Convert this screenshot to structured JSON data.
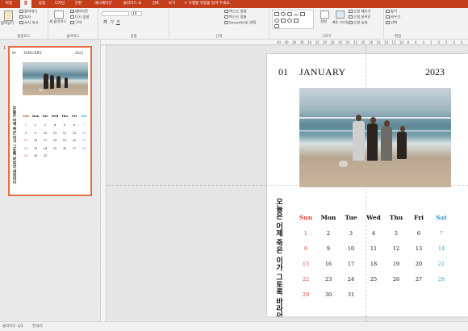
{
  "menu": {
    "tabs": [
      {
        "label": "파일",
        "active": false
      },
      {
        "label": "홈",
        "active": true
      },
      {
        "label": "삽입",
        "active": false
      },
      {
        "label": "디자인",
        "active": false
      },
      {
        "label": "전환",
        "active": false
      },
      {
        "label": "애니메이션",
        "active": false
      },
      {
        "label": "슬라이드 쇼",
        "active": false
      },
      {
        "label": "검토",
        "active": false
      },
      {
        "label": "보기",
        "active": false
      }
    ],
    "tell_me": "수행할 작업을 알려 주세요."
  },
  "ribbon": {
    "clipboard": {
      "paste": "붙여넣기",
      "cut": "잘라내기",
      "copy": "복사",
      "format_painter": "서식 복사",
      "label": "클립보드"
    },
    "slides": {
      "new_slide": "새 슬라이드",
      "layout": "레이아웃",
      "reset": "다시 설정",
      "section": "구역",
      "label": "슬라이드"
    },
    "font": {
      "size": "18",
      "bold": "가",
      "italic": "가",
      "underline": "가",
      "label": "글꼴"
    },
    "paragraph": {
      "text_direction": "텍스트 방향",
      "align_text": "텍스트 맞춤",
      "smartart": "SmartArt로 변환",
      "label": "단락"
    },
    "drawing": {
      "arrange": "정렬",
      "quick_styles": "빠른 스타일",
      "shape_fill": "도형 채우기",
      "shape_outline": "도형 윤곽선",
      "shape_effects": "도형 효과",
      "label": "그리기"
    },
    "editing": {
      "find": "찾기",
      "replace": "바꾸기",
      "select": "선택",
      "label": "편집"
    }
  },
  "thumbnail": {
    "number": "1"
  },
  "ruler": {
    "h_ticks": [
      "44",
      "40",
      "38",
      "36",
      "34",
      "32",
      "30",
      "28",
      "26",
      "24",
      "22",
      "20",
      "18",
      "16",
      "14",
      "12",
      "10",
      "8",
      "6",
      "4",
      "2",
      "0",
      "2",
      "4",
      "6",
      "8",
      "10",
      "12",
      "14",
      "16",
      "18",
      "20",
      "22",
      "24",
      "26",
      "28",
      "30",
      "32",
      "34"
    ]
  },
  "slide": {
    "number": "01",
    "month": "JANUARY",
    "year": "2023",
    "vertical_text": "오늘은 어제 죽은 이가 그토록 바라던 내일이다",
    "weekdays": [
      "Sun",
      "Mon",
      "Tue",
      "Wed",
      "Thu",
      "Fri",
      "Sat"
    ],
    "weeks": [
      [
        "1",
        "2",
        "3",
        "4",
        "5",
        "6",
        "7"
      ],
      [
        "8",
        "9",
        "10",
        "11",
        "12",
        "13",
        "14"
      ],
      [
        "15",
        "16",
        "17",
        "18",
        "19",
        "20",
        "21"
      ],
      [
        "22",
        "23",
        "24",
        "25",
        "26",
        "27",
        "28"
      ],
      [
        "29",
        "30",
        "31",
        "",
        "",
        "",
        ""
      ]
    ],
    "colors": {
      "sunday": "#d9442e",
      "saturday": "#2e9bd6",
      "weekday": "#111111"
    }
  },
  "status": {
    "slide_counter": "슬라이드 1/1",
    "language": "한국어"
  },
  "colors": {
    "accent": "#c43e1c",
    "selection": "#e46c48"
  }
}
